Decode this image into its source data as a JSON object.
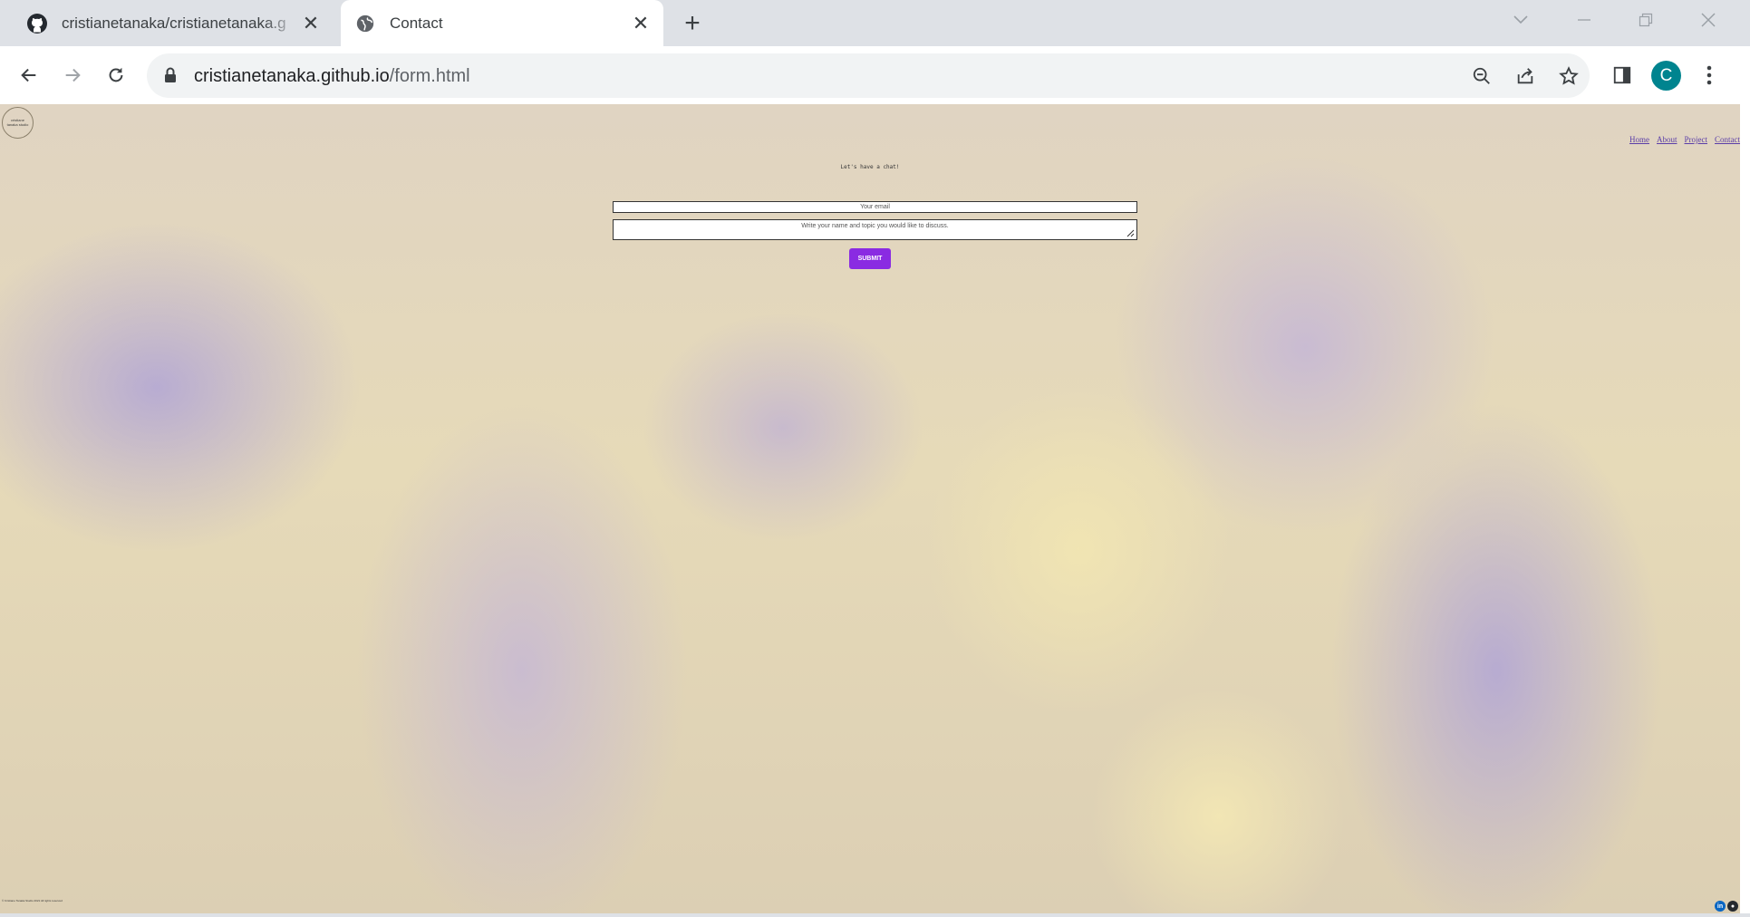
{
  "browser": {
    "tabs": [
      {
        "title": "cristianetanaka/cristianetanaka.g",
        "icon": "github-icon",
        "active": false
      },
      {
        "title": "Contact",
        "icon": "globe-icon",
        "active": true
      }
    ],
    "url_host": "cristianetanaka.github.io",
    "url_path": "/form.html",
    "profile_initial": "C",
    "profile_color": "#00848f"
  },
  "page": {
    "logo_text_line1": "cristiane",
    "logo_text_line2": "tanaka studio",
    "nav": [
      "Home",
      "About",
      "Project",
      "Contact"
    ],
    "heading": "Let's have a chat!",
    "email_placeholder": "Your email",
    "message_placeholder": "Write your name and topic you would like to discuss.",
    "submit_label": "SUBMIT",
    "footer_copyright": "© Cristiane Tanaka Studio 2021 All rights reserved",
    "social": [
      "linkedin-icon",
      "github-icon"
    ],
    "accent_color": "#8a2be2"
  }
}
